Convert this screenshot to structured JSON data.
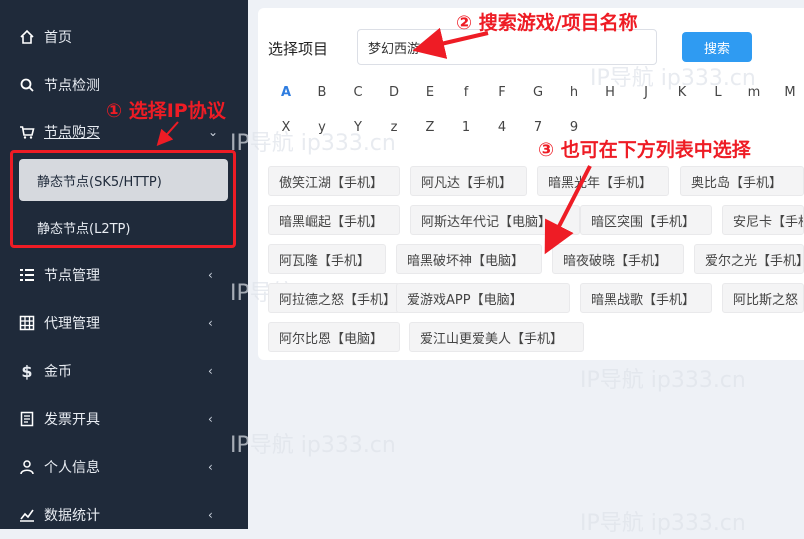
{
  "sidebar": {
    "items": [
      {
        "label": "首页",
        "icon": "home-icon"
      },
      {
        "label": "节点检测",
        "icon": "search-icon"
      },
      {
        "label": "节点购买",
        "icon": "cart-icon"
      },
      {
        "label": "节点管理",
        "icon": "list-icon"
      },
      {
        "label": "代理管理",
        "icon": "grid-icon"
      },
      {
        "label": "金币",
        "icon": "dollar-icon"
      },
      {
        "label": "发票开具",
        "icon": "invoice-icon"
      },
      {
        "label": "个人信息",
        "icon": "user-icon"
      },
      {
        "label": "数据统计",
        "icon": "chart-icon"
      }
    ],
    "submenu": [
      "静态节点(SK5/HTTP)",
      "静态节点(L2TP)"
    ]
  },
  "main": {
    "select_label": "选择项目",
    "search_value": "梦幻西游",
    "search_button": "搜索",
    "letters_row1": [
      "A",
      "B",
      "C",
      "D",
      "E",
      "f",
      "F",
      "G",
      "h",
      "H",
      "J",
      "K",
      "L",
      "m",
      "M"
    ],
    "letters_row2": [
      "X",
      "y",
      "Y",
      "z",
      "Z",
      "1",
      "4",
      "7",
      "9"
    ],
    "tags": [
      [
        "傲笑江湖【手机】",
        "阿凡达【手机】",
        "暗黑光年【手机】",
        "奥比岛【手机】"
      ],
      [
        "暗黑崛起【手机】",
        "阿斯达年代记【电脑】",
        "暗区突围【手机】",
        "安尼卡【手机】"
      ],
      [
        "阿瓦隆【手机】",
        "暗黑破坏神【电脑】",
        "暗夜破晓【手机】",
        "爱尔之光【手机】"
      ],
      [
        "阿拉德之怒【手机】",
        "爱游戏APP【电脑】",
        "暗黑战歌【手机】",
        "阿比斯之怒"
      ],
      [
        "阿尔比恩【电脑】",
        "爱江山更爱美人【手机】"
      ]
    ]
  },
  "annotations": {
    "step1": "① 选择IP协议",
    "step2": "② 搜索游戏/项目名称",
    "step3": "③ 也可在下方列表中选择"
  },
  "watermark": "IP导航  ip333.cn",
  "colors": {
    "accent": "#2f9bf2",
    "annotation": "#ee1c25",
    "sidebar": "#1f2a3a"
  }
}
